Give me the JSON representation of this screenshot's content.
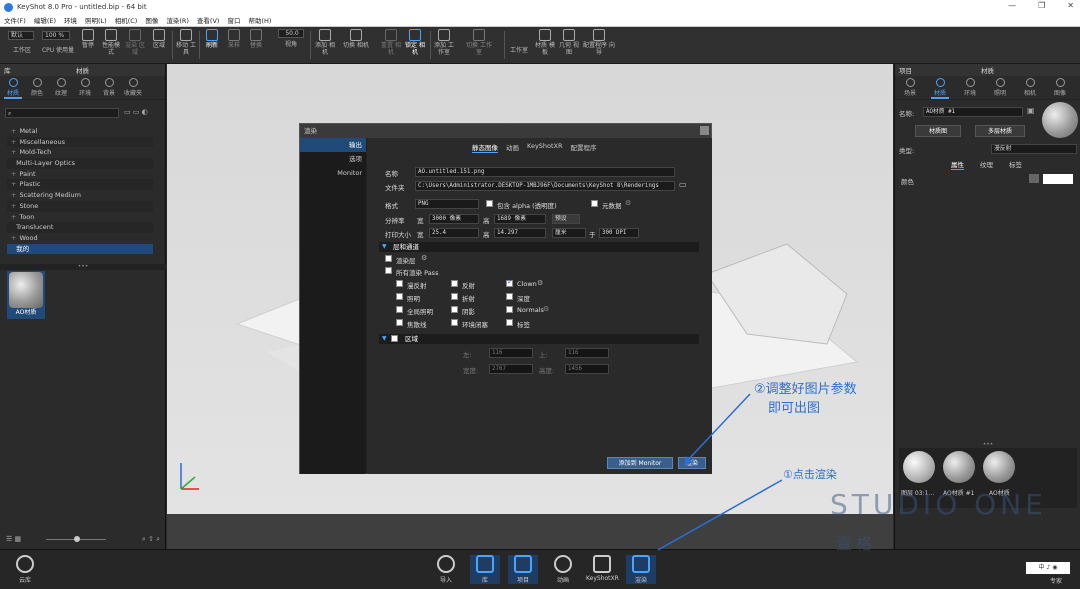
{
  "window": {
    "title": "KeyShot 8.0 Pro - untitled.bip - 64 bit"
  },
  "menu": [
    "文件(F)",
    "编辑(E)",
    "环境",
    "照明(L)",
    "相机(C)",
    "图像",
    "渲染(R)",
    "查看(V)",
    "窗口",
    "帮助(H)"
  ],
  "toolbar": {
    "preset": "默认",
    "zoom": "100 %",
    "items": [
      "工作区",
      "CPU 使用量",
      "暂停",
      "性能模式",
      "渲染 区域",
      "区域",
      "移动 工具",
      "刷新",
      "采样",
      "替换",
      "视角",
      "添加 相机",
      "切换 相机",
      "重置 相机",
      "锁定 相机",
      "添加 工作室",
      "切换 工作室",
      "工作室",
      "材质 模板",
      "几何 视图",
      "配置程序 向导"
    ],
    "fov": "50.0"
  },
  "left_panel": {
    "header_left": "库",
    "header": "材质",
    "tabs": [
      "材质",
      "颜色",
      "纹理",
      "环境",
      "背景",
      "收藏夹"
    ],
    "tree": [
      "Metal",
      "Miscellaneous",
      "Mold-Tech",
      "Multi-Layer Optics",
      "Paint",
      "Plastic",
      "Scattering Medium",
      "Stone",
      "Toon",
      "Translucent",
      "Wood",
      "我的"
    ],
    "thumb_label": "AO材质"
  },
  "dialog": {
    "title": "渲染",
    "nav": [
      "输出",
      "选项",
      "Monitor"
    ],
    "tabs": [
      "静态图像",
      "动画",
      "KeyShotXR",
      "配置程序"
    ],
    "name_label": "名称",
    "name_value": "AO.untitled.151.png",
    "folder_label": "文件夹",
    "folder_value": "C:\\Users\\Administrator.DESKTOP-1MBJ96F\\Documents\\KeyShot 8\\Renderings",
    "format_label": "格式",
    "format_value": "PNG",
    "alpha_label": "包含 alpha (透明度)",
    "meta_label": "元数据",
    "res_label": "分辨率",
    "width_label": "宽",
    "width_value": "3000 像素",
    "height_label": "高",
    "height_value": "1689 像素",
    "preset_btn": "预设",
    "print_label": "打印大小",
    "print_w_label": "宽",
    "print_w": "25.4",
    "print_h_label": "高",
    "print_h": "14.297",
    "unit": "厘米",
    "at": "于",
    "dpi": "300 DPI",
    "layers_section": "层和通道",
    "render_layers": "渲染层",
    "all_passes": "所有渲染 Pass",
    "passes": [
      "漫反射",
      "反射",
      "Clown",
      "照明",
      "折射",
      "深度",
      "全局照明",
      "阴影",
      "Normals",
      "焦散线",
      "环境闭塞",
      "标签"
    ],
    "region_section": "区域",
    "region_left_label": "左:",
    "region_left": "116",
    "region_top_label": "上:",
    "region_top": "116",
    "region_w_label": "宽度:",
    "region_w": "2767",
    "region_h_label": "高度:",
    "region_h": "1456",
    "monitor_btn": "添加到 Monitor",
    "render_btn": "渲染"
  },
  "right_panel": {
    "header_left": "项目",
    "header": "材质",
    "tabs": [
      "场景",
      "材质",
      "环境",
      "照明",
      "相机",
      "图像"
    ],
    "name_label": "名称:",
    "name_value": "AO材质 #1",
    "material_graph": "材质图",
    "multi_layer": "多层材质",
    "type_label": "类型:",
    "type_value": "漫反射",
    "subtabs": [
      "属性",
      "纹理",
      "标签"
    ],
    "color_label": "颜色",
    "library": [
      "图层 03:1...",
      "AO材质 #1",
      "AO材质"
    ]
  },
  "bottom": {
    "cloud": "云库",
    "items": [
      "导入",
      "库",
      "项目",
      "动画",
      "KeyShotXR",
      "渲染"
    ],
    "expert": "专家"
  },
  "annotations": {
    "step2_line1": "②调整好图片参数",
    "step2_line2": "即可出图",
    "step1": "①点击渲染",
    "watermark_top": "STUDIO ONE",
    "watermark_bottom": "壹格"
  }
}
